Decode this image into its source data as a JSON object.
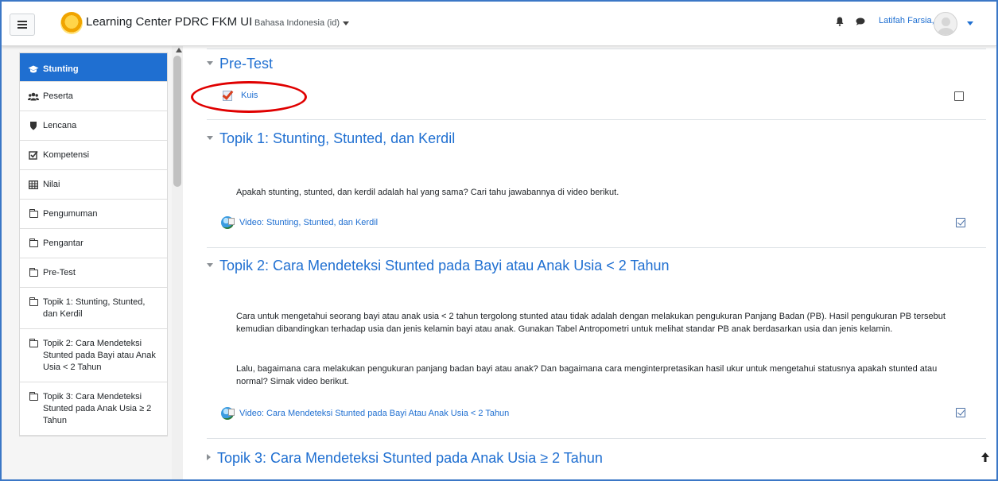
{
  "navbar": {
    "brand": "Learning Center PDRC FKM UI",
    "language": "Bahasa Indonesia (id)",
    "username": "Latifah Farsia, SGz"
  },
  "sidebar": {
    "items": [
      {
        "label": "Stunting",
        "icon": "graduation-cap-icon",
        "active": true
      },
      {
        "label": "Peserta",
        "icon": "users-icon"
      },
      {
        "label": "Lencana",
        "icon": "shield-icon"
      },
      {
        "label": "Kompetensi",
        "icon": "checkbox-icon"
      },
      {
        "label": "Nilai",
        "icon": "table-icon"
      },
      {
        "label": "Pengumuman",
        "icon": "folder-icon"
      },
      {
        "label": "Pengantar",
        "icon": "folder-icon"
      },
      {
        "label": "Pre-Test",
        "icon": "folder-icon"
      },
      {
        "label": "Topik 1: Stunting, Stunted, dan Kerdil",
        "icon": "folder-icon"
      },
      {
        "label": "Topik 2: Cara Mendeteksi Stunted pada Bayi atau Anak Usia < 2 Tahun",
        "icon": "folder-icon"
      },
      {
        "label": "Topik 3: Cara Mendeteksi Stunted pada Anak Usia ≥ 2 Tahun",
        "icon": "folder-icon"
      }
    ]
  },
  "sections": {
    "pretest": {
      "title": "Pre-Test",
      "activity": "Kuis",
      "completed": false
    },
    "topik1": {
      "title": "Topik 1: Stunting, Stunted, dan Kerdil",
      "summary": "Apakah stunting, stunted, dan kerdil adalah hal yang sama? Cari tahu jawabannya di video berikut.",
      "activity": "Video: Stunting, Stunted, dan Kerdil",
      "completed": true
    },
    "topik2": {
      "title": "Topik 2: Cara Mendeteksi Stunted pada Bayi atau Anak Usia < 2 Tahun",
      "summary_1": "Cara untuk mengetahui seorang bayi atau anak usia < 2 tahun tergolong stunted atau tidak adalah dengan melakukan pengukuran Panjang Badan (PB). Hasil pengukuran PB tersebut kemudian dibandingkan terhadap usia dan jenis kelamin bayi atau anak. Gunakan Tabel Antropometri untuk melihat standar PB anak berdasarkan usia dan jenis kelamin.",
      "summary_2": "Lalu, bagaimana cara melakukan pengukuran panjang badan bayi atau anak? Dan bagaimana cara menginterpretasikan hasil ukur untuk mengetahui statusnya apakah stunted atau normal? Simak video berikut.",
      "activity": "Video: Cara Mendeteksi Stunted pada Bayi Atau Anak Usia < 2 Tahun",
      "completed": true
    },
    "topik3": {
      "title": "Topik 3: Cara Mendeteksi Stunted pada Anak Usia ≥ 2 Tahun"
    }
  }
}
